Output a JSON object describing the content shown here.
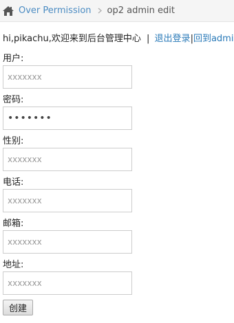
{
  "breadcrumb": {
    "home_icon": "home-icon",
    "parent": "Over Permission",
    "separator": ">",
    "current": "op2 admin edit"
  },
  "welcome": {
    "text": "hi,pikachu,欢迎来到后台管理中心",
    "divider": "|",
    "logout": "退出登录",
    "back": "回到admin"
  },
  "form": {
    "username": {
      "label": "用户:",
      "placeholder": "xxxxxxx"
    },
    "password": {
      "label": "密码:",
      "value": "xxxxxxx"
    },
    "gender": {
      "label": "性别:",
      "placeholder": "xxxxxxx"
    },
    "phone": {
      "label": "电话:",
      "placeholder": "xxxxxxx"
    },
    "email": {
      "label": "邮箱:",
      "placeholder": "xxxxxxx"
    },
    "address": {
      "label": "地址:",
      "placeholder": "xxxxxxx"
    },
    "submit": "创建"
  },
  "colors": {
    "link": "#4a8bc2",
    "breadcrumb_bg": "#f5f5f5"
  }
}
